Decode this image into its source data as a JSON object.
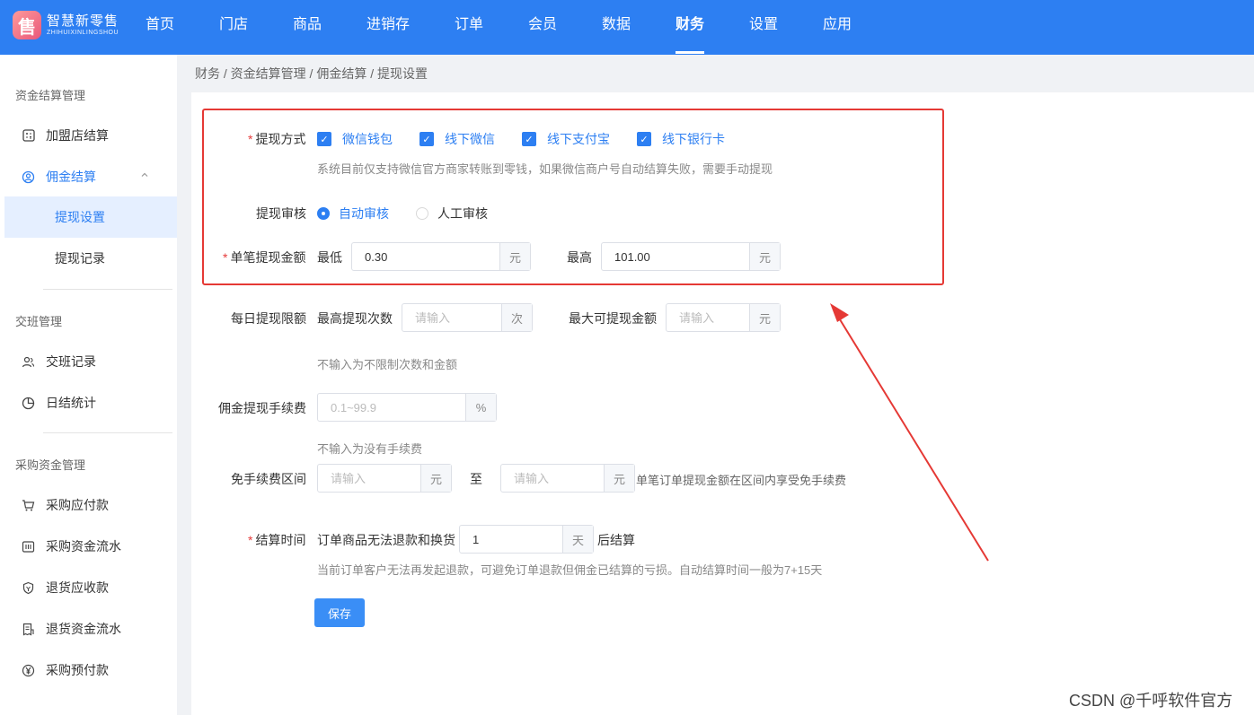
{
  "app": {
    "logo_mark": "售",
    "logo_name": "智慧新零售",
    "logo_sub": "ZHIHUIXINLINGSHOU"
  },
  "nav": [
    {
      "label": "首页"
    },
    {
      "label": "门店"
    },
    {
      "label": "商品"
    },
    {
      "label": "进销存"
    },
    {
      "label": "订单"
    },
    {
      "label": "会员"
    },
    {
      "label": "数据"
    },
    {
      "label": "财务",
      "active": true
    },
    {
      "label": "设置"
    },
    {
      "label": "应用"
    }
  ],
  "sidebar": {
    "groups": [
      "资金结算管理",
      "交班管理",
      "采购资金管理"
    ],
    "items": [
      {
        "label": "加盟店结算",
        "icon": "calculator-icon"
      },
      {
        "label": "佣金结算",
        "icon": "user-coin-icon"
      },
      {
        "label": "交班记录",
        "icon": "users-icon"
      },
      {
        "label": "日结统计",
        "icon": "pie-chart-icon"
      },
      {
        "label": "采购应付款",
        "icon": "cart-icon"
      },
      {
        "label": "采购资金流水",
        "icon": "ledger-icon"
      },
      {
        "label": "退货应收款",
        "icon": "shield-icon"
      },
      {
        "label": "退货资金流水",
        "icon": "receipt-icon"
      },
      {
        "label": "采购预付款",
        "icon": "yen-icon"
      }
    ],
    "subitems": [
      {
        "label": "提现设置",
        "active": true
      },
      {
        "label": "提现记录"
      }
    ]
  },
  "breadcrumb": {
    "text": "财务 / 资金结算管理 / 佣金结算 / 提现设置"
  },
  "form": {
    "withdraw_method": {
      "label": "提现方式",
      "options": [
        "微信钱包",
        "线下微信",
        "线下支付宝",
        "线下银行卡"
      ],
      "hint": "系统目前仅支持微信官方商家转账到零钱，如果微信商户号自动结算失败，需要手动提现"
    },
    "review": {
      "label": "提现审核",
      "auto": "自动审核",
      "manual": "人工审核",
      "selected": "自动审核"
    },
    "single_amount": {
      "label": "单笔提现金额",
      "min_label": "最低",
      "min_value": "0.30",
      "max_label": "最高",
      "max_value": "101.00",
      "unit": "元"
    },
    "daily_limit": {
      "label": "每日提现限额",
      "count_label": "最高提现次数",
      "count_placeholder": "请输入",
      "count_unit": "次",
      "amount_label": "最大可提现金额",
      "amount_placeholder": "请输入",
      "amount_unit": "元",
      "hint": "不输入为不限制次数和金额"
    },
    "fee": {
      "label": "佣金提现手续费",
      "placeholder": "0.1~99.9",
      "unit": "%",
      "hint": "不输入为没有手续费"
    },
    "free_range": {
      "label": "免手续费区间",
      "from_placeholder": "请输入",
      "unit": "元",
      "to_label": "至",
      "to_placeholder": "请输入",
      "hint": "单笔订单提现金额在区间内享受免手续费"
    },
    "settle_time": {
      "label": "结算时间",
      "prefix": "订单商品无法退款和换货",
      "value": "1",
      "unit": "天",
      "suffix": "后结算",
      "hint": "当前订单客户无法再发起退款，可避免订单退款但佣金已结算的亏损。自动结算时间一般为7+15天"
    },
    "save_label": "保存"
  },
  "annotation": {
    "color": "#e53935"
  },
  "watermark": "CSDN @千呼软件官方"
}
